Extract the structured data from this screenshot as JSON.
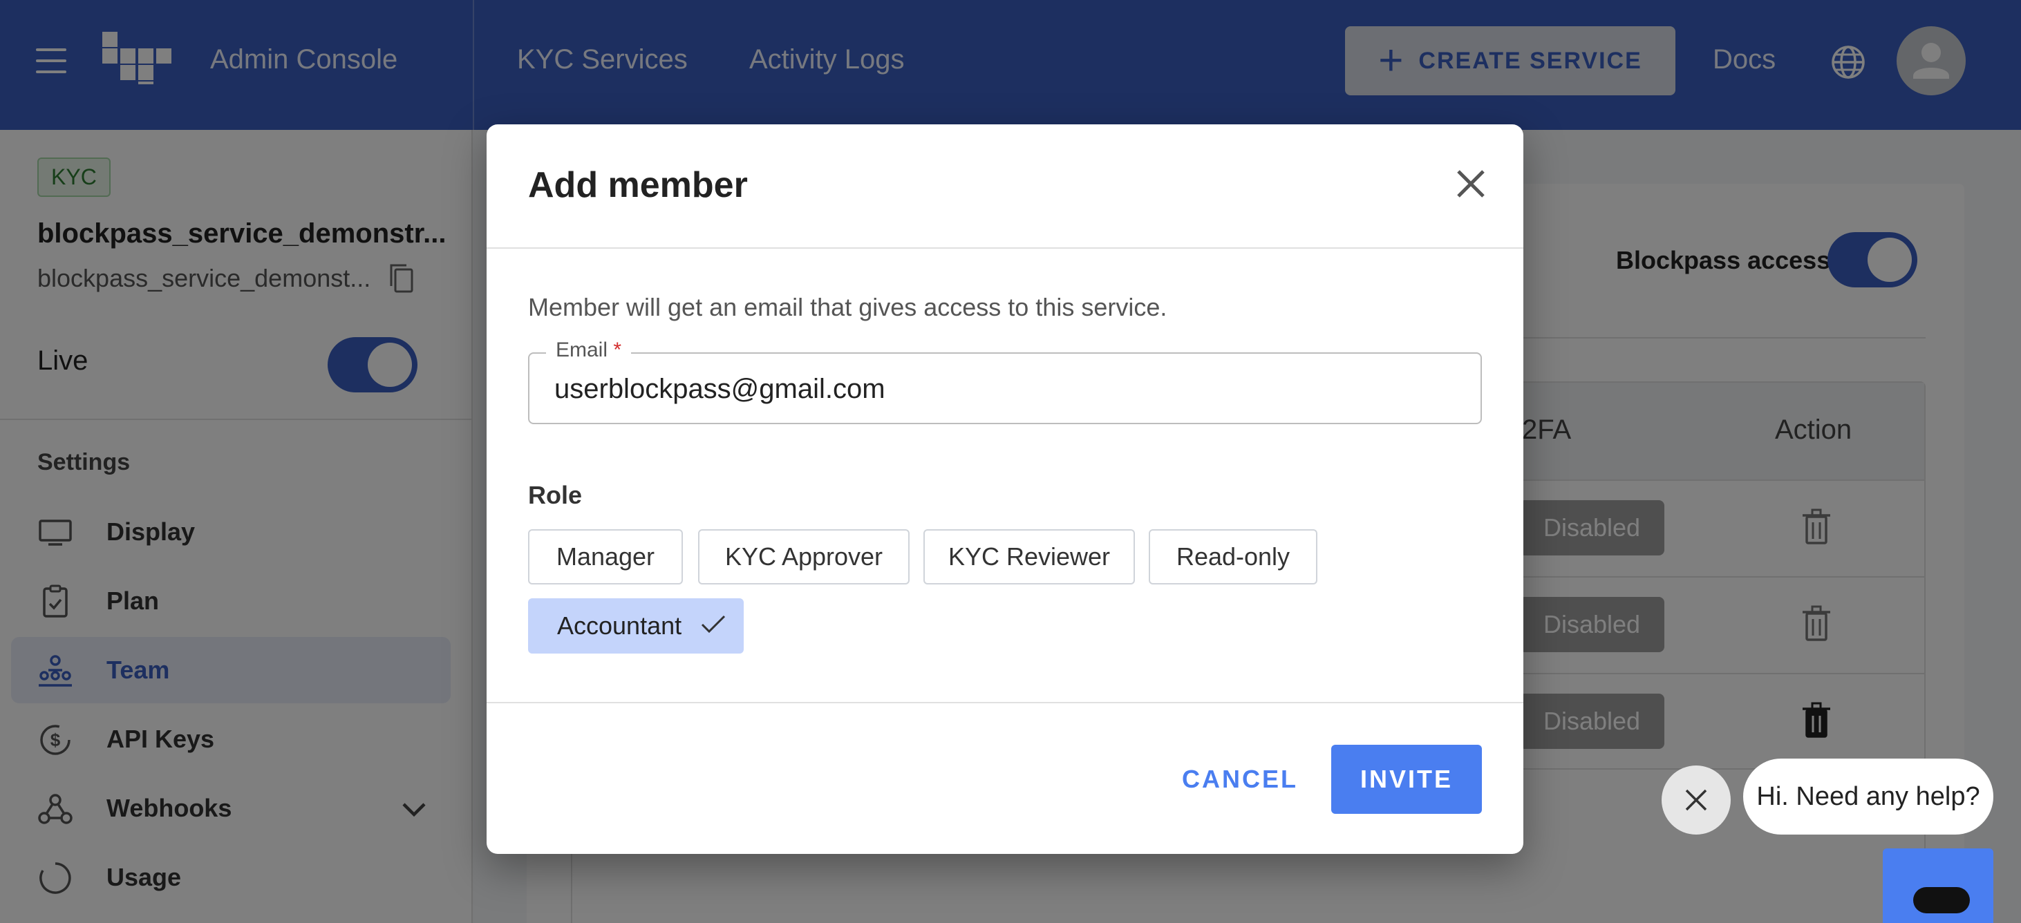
{
  "topbar": {
    "app_title": "Admin Console",
    "nav": [
      "KYC Services",
      "Activity Logs"
    ],
    "create_label": "CREATE SERVICE",
    "docs_label": "Docs"
  },
  "sidebar": {
    "badge": "KYC",
    "service_name": "blockpass_service_demonstr...",
    "service_id": "blockpass_service_demonst...",
    "live_label": "Live",
    "live_on": true,
    "settings_label": "Settings",
    "items": [
      {
        "label": "Display",
        "icon": "monitor-icon"
      },
      {
        "label": "Plan",
        "icon": "clipboard-icon"
      },
      {
        "label": "Team",
        "icon": "team-icon",
        "active": true
      },
      {
        "label": "API Keys",
        "icon": "key-icon"
      },
      {
        "label": "Webhooks",
        "icon": "webhook-icon"
      },
      {
        "label": "Usage",
        "icon": "usage-icon"
      }
    ]
  },
  "content": {
    "blockpass_access_label": "Blockpass access",
    "blockpass_access_on": true,
    "columns": [
      "2FA",
      "Action"
    ],
    "rows": [
      {
        "twofa": "Disabled"
      },
      {
        "twofa": "Disabled"
      },
      {
        "twofa": "Disabled"
      }
    ]
  },
  "modal": {
    "title": "Add member",
    "description": "Member will get an email that gives access to this service.",
    "email_label": "Email",
    "email_required_mark": "*",
    "email_value": "userblockpass@gmail.com",
    "role_label": "Role",
    "roles": [
      "Manager",
      "KYC Approver",
      "KYC Reviewer",
      "Read-only",
      "Accountant"
    ],
    "selected_role": "Accountant",
    "cancel_label": "CANCEL",
    "invite_label": "INVITE"
  },
  "chat": {
    "bubble_text": "Hi. Need any help?"
  },
  "colors": {
    "brand_blue": "#3b5fc0",
    "button_blue": "#4a7ef0",
    "selected_chip": "#c4d4fb"
  }
}
